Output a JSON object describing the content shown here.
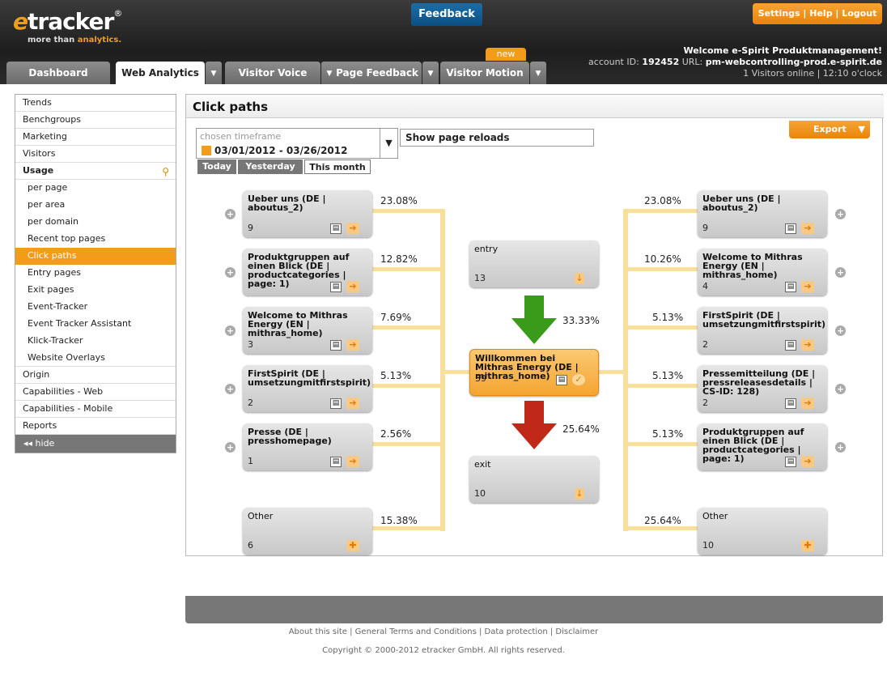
{
  "header": {
    "logo_e": "e",
    "logo_rest": "tracker",
    "logo_reg": "®",
    "tagline_a": "more than ",
    "tagline_b": "analytics.",
    "feedback": "Feedback",
    "toplinks": "Settings | Help | Logout",
    "welcome": "Welcome e-Spirit Produktmanagement!",
    "account_label": "account ID: ",
    "account_id": "192452",
    "url_label": " URL: ",
    "url": "pm-webcontrolling-prod.e-spirit.de",
    "online": "1 Visitors online | 12:10 o'clock",
    "new_badge": "new"
  },
  "tabs": {
    "dashboard": "Dashboard",
    "web_analytics": "Web Analytics",
    "visitor_voice": "Visitor Voice",
    "page_feedback": "Page Feedback",
    "visitor_motion": "Visitor Motion"
  },
  "sidebar": {
    "trends": "Trends",
    "benchgroups": "Benchgroups",
    "marketing": "Marketing",
    "visitors": "Visitors",
    "usage": "Usage",
    "per_page": "per page",
    "per_area": "per area",
    "per_domain": "per domain",
    "recent_top_pages": "Recent top pages",
    "click_paths": "Click paths",
    "entry_pages": "Entry pages",
    "exit_pages": "Exit pages",
    "event_tracker": "Event-Tracker",
    "event_tracker_assistant": "Event Tracker Assistant",
    "klick_tracker": "Klick-Tracker",
    "website_overlays": "Website Overlays",
    "origin": "Origin",
    "cap_web": "Capabilities - Web",
    "cap_mobile": "Capabilities - Mobile",
    "reports": "Reports",
    "hide": "◂◂ hide"
  },
  "main": {
    "title": "Click paths",
    "timeframe_label": "chosen timeframe",
    "timeframe_value": "03/01/2012 - 03/26/2012",
    "show_reloads": "Show page reloads",
    "today": "Today",
    "yesterday": "Yesterday",
    "this_month": "This month",
    "export": "Export"
  },
  "paths": {
    "left": [
      {
        "title": "Ueber uns (DE | aboutus_2)",
        "count": "9",
        "pct": "23.08%"
      },
      {
        "title": "Produktgruppen auf einen Blick (DE | productcategories | page: 1)",
        "count": "",
        "pct": "12.82%"
      },
      {
        "title": "Welcome to Mithras Energy (EN | mithras_home)",
        "count": "3",
        "pct": "7.69%"
      },
      {
        "title": "FirstSpirit (DE | umsetzungmitfirstspirit)",
        "count": "2",
        "pct": "5.13%"
      },
      {
        "title": "Presse (DE | presshomepage)",
        "count": "1",
        "pct": "2.56%"
      },
      {
        "title": "Other",
        "count": "6",
        "pct": "15.38%"
      }
    ],
    "right": [
      {
        "title": "Ueber uns (DE | aboutus_2)",
        "count": "9",
        "pct": "23.08%"
      },
      {
        "title": "Welcome to Mithras Energy (EN | mithras_home)",
        "count": "4",
        "pct": "10.26%"
      },
      {
        "title": "FirstSpirit (DE | umsetzungmitfirstspirit)",
        "count": "2",
        "pct": "5.13%"
      },
      {
        "title": "Pressemitteilung (DE | pressreleasesdetails | CS-ID: 128)",
        "count": "2",
        "pct": "5.13%"
      },
      {
        "title": "Produktgruppen auf einen Blick (DE | productcategories | page: 1)",
        "count": "",
        "pct": "5.13%"
      },
      {
        "title": "Other",
        "count": "10",
        "pct": "25.64%"
      }
    ],
    "entry": {
      "title": "entry",
      "count": "13",
      "pct": "33.33%"
    },
    "center": {
      "title": "Willkommen bei Mithras Energy (DE | mithras_home)",
      "count": "39"
    },
    "exit": {
      "title": "exit",
      "count": "10",
      "pct": "25.64%"
    }
  },
  "footer": {
    "links": "About this site | General Terms and Conditions | Data protection | Disclaimer",
    "copyright": "Copyright © 2000-2012 etracker GmbH. All rights reserved."
  },
  "colors": {
    "accent": "#f39c1a",
    "feedback": "#0c4f84",
    "arrow_green": "#3a9a1a",
    "arrow_red": "#c0281a"
  }
}
